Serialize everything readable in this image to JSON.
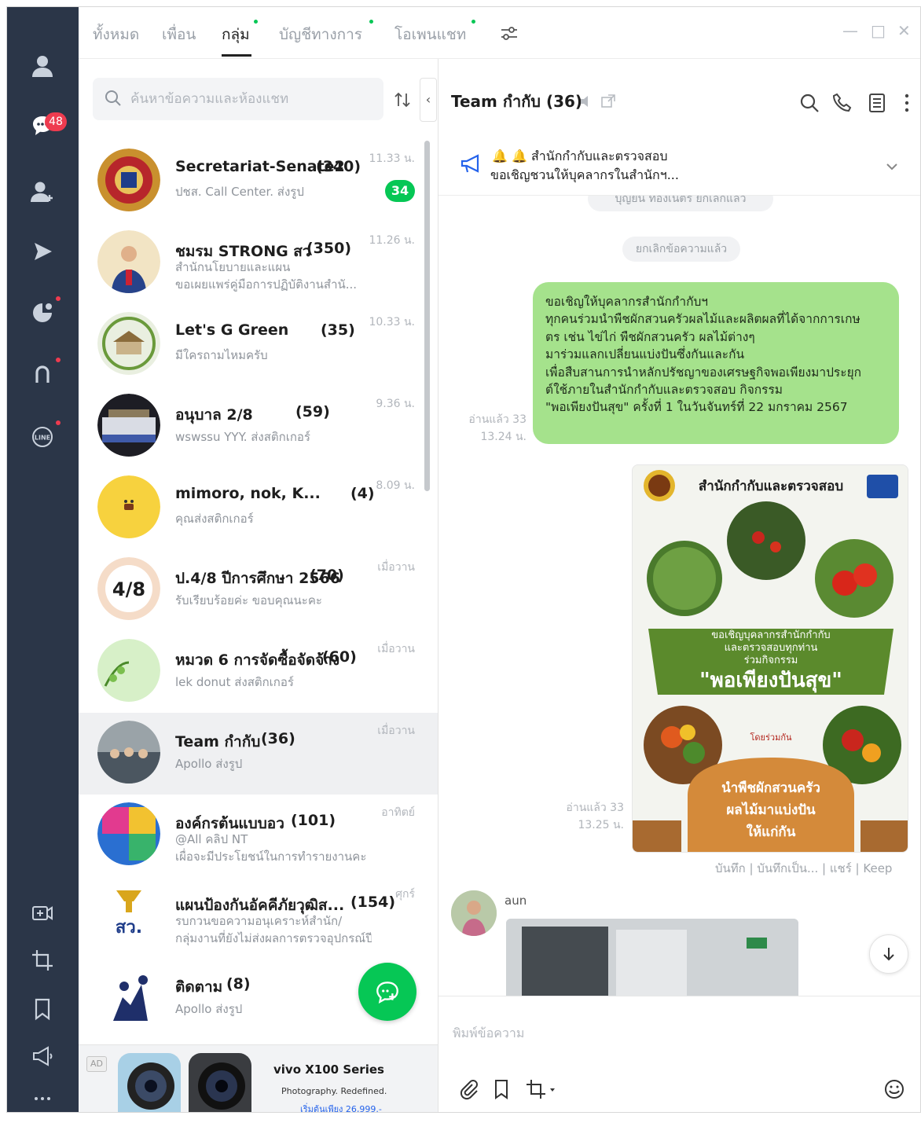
{
  "rail": {
    "chat_badge": "48"
  },
  "tabs": {
    "items": [
      {
        "label": "ทั้งหมด"
      },
      {
        "label": "เพื่อน"
      },
      {
        "label": "กลุ่ม"
      },
      {
        "label": "บัญชีทางการ"
      },
      {
        "label": "โอเพนแชท"
      }
    ],
    "active": "กลุ่ม"
  },
  "window": {
    "minimize": "—",
    "maximize": "□",
    "close": "✕"
  },
  "search": {
    "placeholder": "ค้นหาข้อความและห้องแชท"
  },
  "chats": [
    {
      "name": "Secretariat-Senate2",
      "count": "(340)",
      "preview": "ปชส. Call Center. ส่งรูป",
      "preview2": "",
      "time": "11.33 น.",
      "unread": "34"
    },
    {
      "name": "ชมรม STRONG สว",
      "count": "(350)",
      "preview": "สำนักนโยบายและแผน",
      "preview2": "ขอเผยแพร่คู่มือการปฏิบัติงานสำนั...",
      "time": "11.26 น.",
      "unread": ""
    },
    {
      "name": "Let's G Green",
      "count": "(35)",
      "preview": "มีใครถามไหมครับ",
      "preview2": "",
      "time": "10.33 น.",
      "unread": ""
    },
    {
      "name": "อนุบาล 2/8",
      "count": "(59)",
      "preview": "wswssu YYY. ส่งสติกเกอร์",
      "preview2": "",
      "time": "9.36 น.",
      "unread": ""
    },
    {
      "name": "mimoro, nok, K...",
      "count": "(4)",
      "preview": "คุณส่งสติกเกอร์",
      "preview2": "",
      "time": "8.09 น.",
      "unread": ""
    },
    {
      "name": "ป.4/8 ปีการศึกษา 2566",
      "count": "(70)",
      "preview": "รับเรียบร้อยค่ะ ขอบคุณนะคะ",
      "preview2": "",
      "time": "เมื่อวาน",
      "unread": ""
    },
    {
      "name": "หมวด 6 การจัดซื้อจัดจ้าง",
      "count": "(60)",
      "preview": "lek donut ส่งสติกเกอร์",
      "preview2": "",
      "time": "เมื่อวาน",
      "unread": ""
    },
    {
      "name": "Team กำกับ",
      "count": "(36)",
      "preview": "Apollo ส่งรูป",
      "preview2": "",
      "time": "เมื่อวาน",
      "unread": ""
    },
    {
      "name": "องค์กรต้นแบบอว",
      "count": "(101)",
      "preview": "@All คลิป NT",
      "preview2": "เผื่อจะมีประโยชน์ในการทำรายงานคะ",
      "time": "อาทิตย์",
      "unread": ""
    },
    {
      "name": "แผนป้องกันอัคคีภัยวุฒิส...",
      "count": "(154)",
      "preview": "รบกวนขอความอนุเคราะห์สำนัก/",
      "preview2": "กลุ่มงานที่ยังไม่ส่งผลการตรวจอุปกรณ์ปี...",
      "time": "ศุกร์",
      "unread": ""
    },
    {
      "name": "ติดตาม",
      "count": "(8)",
      "preview": "Apollo ส่งรูป",
      "preview2": "",
      "time": "",
      "unread": ""
    }
  ],
  "ad": {
    "label": "AD",
    "title": "vivo X100 Series",
    "subtitle": "Photography. Redefined.",
    "price": "เริ่มต้นเพียง 26,999.-"
  },
  "conversation": {
    "title": "Team กำกับ (36)",
    "announcement_line1": "สำนักกำกับและตรวจสอบ",
    "announcement_line2": "ขอเชิญชวนให้บุคลากรในสำนักฯ...",
    "top_pill": "บุญยืน ทองเนตร ยกเลิกแล้ว",
    "unsent_pill": "ยกเลิกข้อความแล้ว",
    "message_lines": [
      "ขอเชิญให้บุคลากรสำนักกำกับฯ",
      "ทุกคนร่วมนำพืชผักสวนครัวผลไม้และผลิตผลที่ได้จากการเกษ",
      "ตร เช่น ไข่ไก่ พืชผักสวนครัว ผลไม้ต่างๆ",
      "มาร่วมแลกเปลี่ยนแบ่งปันซึ่งกันและกัน",
      "เพื่อสืบสานการนำหลักปรัชญาของเศรษฐกิจพอเพียงมาประยุก",
      "ต์ใช้ภายในสำนักกำกับและตรวจสอบ กิจกรรม",
      "\"พอเพียงปันสุข\" ครั้งที่ 1 ในวันจันทร์ที่ 22 มกราคม 2567"
    ],
    "msg1_read": "อ่านแล้ว 33",
    "msg1_time": "13.24 น.",
    "msg2_read": "อ่านแล้ว 33",
    "msg2_time": "13.25 น.",
    "poster": {
      "header": "สำนักกำกับและตรวจสอบ",
      "invite1": "ขอเชิญบุคลากรสำนักกำกับ",
      "invite2": "และตรวจสอบทุกท่าน",
      "invite3": "ร่วมกิจกรรม",
      "slogan": "\"พอเพียงปันสุข\"",
      "join_label": "โดยร่วมกัน",
      "bottom1": "นำพืชผักสวนครัว",
      "bottom2": "ผลไม้มาแบ่งปัน",
      "bottom3": "ให้แก่กัน"
    },
    "image_actions": "บันทึก | บันทึกเป็น... | แชร์ | Keep",
    "sender": "aun",
    "composer_placeholder": "พิมพ์ข้อความ"
  }
}
